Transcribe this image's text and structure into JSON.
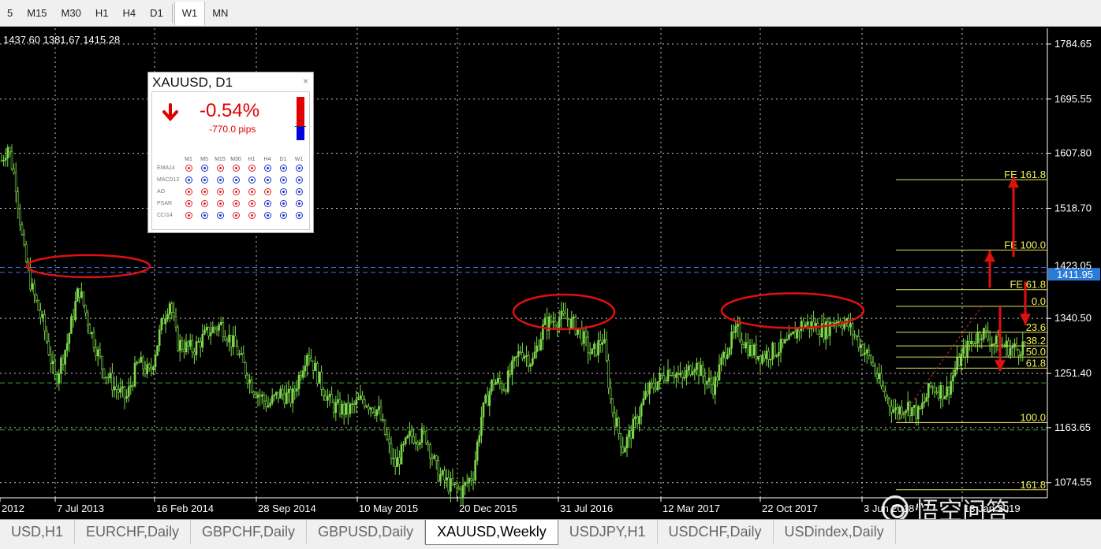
{
  "toolbar": {
    "timeframes": [
      {
        "label": "5",
        "active": false
      },
      {
        "label": "M15",
        "active": false
      },
      {
        "label": "M30",
        "active": false
      },
      {
        "label": "H1",
        "active": false
      },
      {
        "label": "H4",
        "active": false
      },
      {
        "label": "D1",
        "active": false
      },
      {
        "label": "W1",
        "active": true
      },
      {
        "label": "MN",
        "active": false
      }
    ]
  },
  "chart": {
    "ohlc_text": "1437.60 1381.67 1415.28",
    "current_price_label": "1411.95",
    "bid_tag": "1423.05",
    "watermark": "悟空问答"
  },
  "chart_data": {
    "type": "candlestick",
    "symbol": "XAUUSD",
    "timeframe": "Weekly",
    "y_ticks": [
      1784.65,
      1695.55,
      1607.8,
      1518.7,
      1340.5,
      1251.4,
      1163.65,
      1074.55
    ],
    "ylim": [
      1050,
      1810
    ],
    "x_ticks": [
      "2012",
      "7 Jul 2013",
      "16 Feb 2014",
      "28 Sep 2014",
      "10 May 2015",
      "20 Dec 2015",
      "31 Jul 2016",
      "12 Mar 2017",
      "22 Oct 2017",
      "3 Jun 2018",
      "13 Jan 2019"
    ],
    "price_path": [
      [
        0,
        1590
      ],
      [
        10,
        1620
      ],
      [
        20,
        1560
      ],
      [
        30,
        1450
      ],
      [
        40,
        1390
      ],
      [
        55,
        1330
      ],
      [
        70,
        1240
      ],
      [
        85,
        1300
      ],
      [
        100,
        1390
      ],
      [
        115,
        1320
      ],
      [
        130,
        1260
      ],
      [
        145,
        1230
      ],
      [
        160,
        1210
      ],
      [
        175,
        1270
      ],
      [
        190,
        1250
      ],
      [
        205,
        1330
      ],
      [
        215,
        1370
      ],
      [
        225,
        1300
      ],
      [
        245,
        1290
      ],
      [
        265,
        1320
      ],
      [
        280,
        1330
      ],
      [
        300,
        1290
      ],
      [
        320,
        1230
      ],
      [
        340,
        1200
      ],
      [
        355,
        1220
      ],
      [
        370,
        1210
      ],
      [
        390,
        1290
      ],
      [
        405,
        1240
      ],
      [
        420,
        1200
      ],
      [
        440,
        1190
      ],
      [
        460,
        1210
      ],
      [
        480,
        1190
      ],
      [
        500,
        1100
      ],
      [
        520,
        1150
      ],
      [
        540,
        1150
      ],
      [
        555,
        1090
      ],
      [
        570,
        1070
      ],
      [
        585,
        1060
      ],
      [
        600,
        1090
      ],
      [
        610,
        1180
      ],
      [
        625,
        1240
      ],
      [
        640,
        1230
      ],
      [
        660,
        1290
      ],
      [
        675,
        1270
      ],
      [
        690,
        1330
      ],
      [
        705,
        1340
      ],
      [
        720,
        1340
      ],
      [
        735,
        1320
      ],
      [
        750,
        1280
      ],
      [
        765,
        1310
      ],
      [
        775,
        1200
      ],
      [
        790,
        1130
      ],
      [
        805,
        1170
      ],
      [
        820,
        1220
      ],
      [
        835,
        1240
      ],
      [
        850,
        1260
      ],
      [
        865,
        1240
      ],
      [
        880,
        1270
      ],
      [
        895,
        1240
      ],
      [
        905,
        1230
      ],
      [
        920,
        1290
      ],
      [
        935,
        1320
      ],
      [
        950,
        1290
      ],
      [
        965,
        1280
      ],
      [
        985,
        1290
      ],
      [
        1000,
        1300
      ],
      [
        1015,
        1330
      ],
      [
        1030,
        1330
      ],
      [
        1045,
        1320
      ],
      [
        1060,
        1340
      ],
      [
        1075,
        1330
      ],
      [
        1090,
        1300
      ],
      [
        1105,
        1270
      ],
      [
        1120,
        1220
      ],
      [
        1135,
        1190
      ],
      [
        1150,
        1200
      ],
      [
        1165,
        1185
      ],
      [
        1180,
        1230
      ],
      [
        1200,
        1220
      ],
      [
        1215,
        1270
      ],
      [
        1230,
        1300
      ],
      [
        1245,
        1320
      ],
      [
        1260,
        1300
      ],
      [
        1275,
        1295
      ],
      [
        1290,
        1290
      ],
      [
        1300,
        1300
      ]
    ],
    "horizontal_lines": [
      {
        "price": 1423.05,
        "style": "dashed",
        "color": "#4a6cf0"
      },
      {
        "price": 1415.0,
        "style": "dashed",
        "color": "#4a6cf0"
      },
      {
        "price": 1236.0,
        "style": "dashed",
        "color": "#3fa03f"
      },
      {
        "price": 1160.0,
        "style": "dashed",
        "color": "#3fa03f"
      }
    ],
    "fibonacci_levels": [
      {
        "label": "FE 161.8",
        "price": 1565
      },
      {
        "label": "FE 100.0",
        "price": 1451
      },
      {
        "label": "FE 61.8",
        "price": 1387
      },
      {
        "label": "0.0",
        "price": 1360
      },
      {
        "label": "23.6",
        "price": 1318
      },
      {
        "label": "38.2",
        "price": 1296
      },
      {
        "label": "50.0",
        "price": 1278
      },
      {
        "label": "61.8",
        "price": 1260
      },
      {
        "label": "100.0",
        "price": 1172
      },
      {
        "label": "161.8",
        "price": 1063
      }
    ],
    "ellipses": [
      {
        "x_pos": 112,
        "price": 1425
      },
      {
        "x_pos": 715,
        "price": 1351
      },
      {
        "x_pos": 1005,
        "price": 1353
      }
    ],
    "arrows": [
      {
        "direction": "up",
        "x_pos": 1285,
        "from": 1440,
        "to": 1570
      },
      {
        "direction": "up",
        "x_pos": 1255,
        "from": 1390,
        "to": 1450
      },
      {
        "direction": "down",
        "x_pos": 1268,
        "from": 1360,
        "to": 1255
      },
      {
        "direction": "down",
        "x_pos": 1300,
        "from": 1400,
        "to": 1330
      }
    ]
  },
  "widget": {
    "title": "XAUUSD, D1",
    "close": "×",
    "change_pct": "-0.54%",
    "pips": "-770.0 pips",
    "timeframes": [
      "M1",
      "M5",
      "M15",
      "M30",
      "H1",
      "H4",
      "D1",
      "W1"
    ],
    "indicators": [
      {
        "name": "EMA14",
        "signals": [
          "dn",
          "up",
          "dn",
          "dn",
          "dn",
          "up",
          "up",
          "up"
        ]
      },
      {
        "name": "MACD12",
        "signals": [
          "up",
          "up",
          "up",
          "up",
          "up",
          "up",
          "up",
          "up"
        ]
      },
      {
        "name": "AO",
        "signals": [
          "dn",
          "dn",
          "dn",
          "dn",
          "dn",
          "dn",
          "up",
          "up"
        ]
      },
      {
        "name": "PSAR",
        "signals": [
          "dn",
          "dn",
          "dn",
          "dn",
          "dn",
          "up",
          "up",
          "up"
        ]
      },
      {
        "name": "CCI14",
        "signals": [
          "dn",
          "up",
          "up",
          "dn",
          "dn",
          "up",
          "up",
          "up"
        ]
      }
    ]
  },
  "tabs": [
    {
      "label": "USD,H1",
      "active": false
    },
    {
      "label": "EURCHF,Daily",
      "active": false
    },
    {
      "label": "GBPCHF,Daily",
      "active": false
    },
    {
      "label": "GBPUSD,Daily",
      "active": false
    },
    {
      "label": "XAUUSD,Weekly",
      "active": true
    },
    {
      "label": "USDJPY,H1",
      "active": false
    },
    {
      "label": "USDCHF,Daily",
      "active": false
    },
    {
      "label": "USDindex,Daily",
      "active": false
    }
  ]
}
